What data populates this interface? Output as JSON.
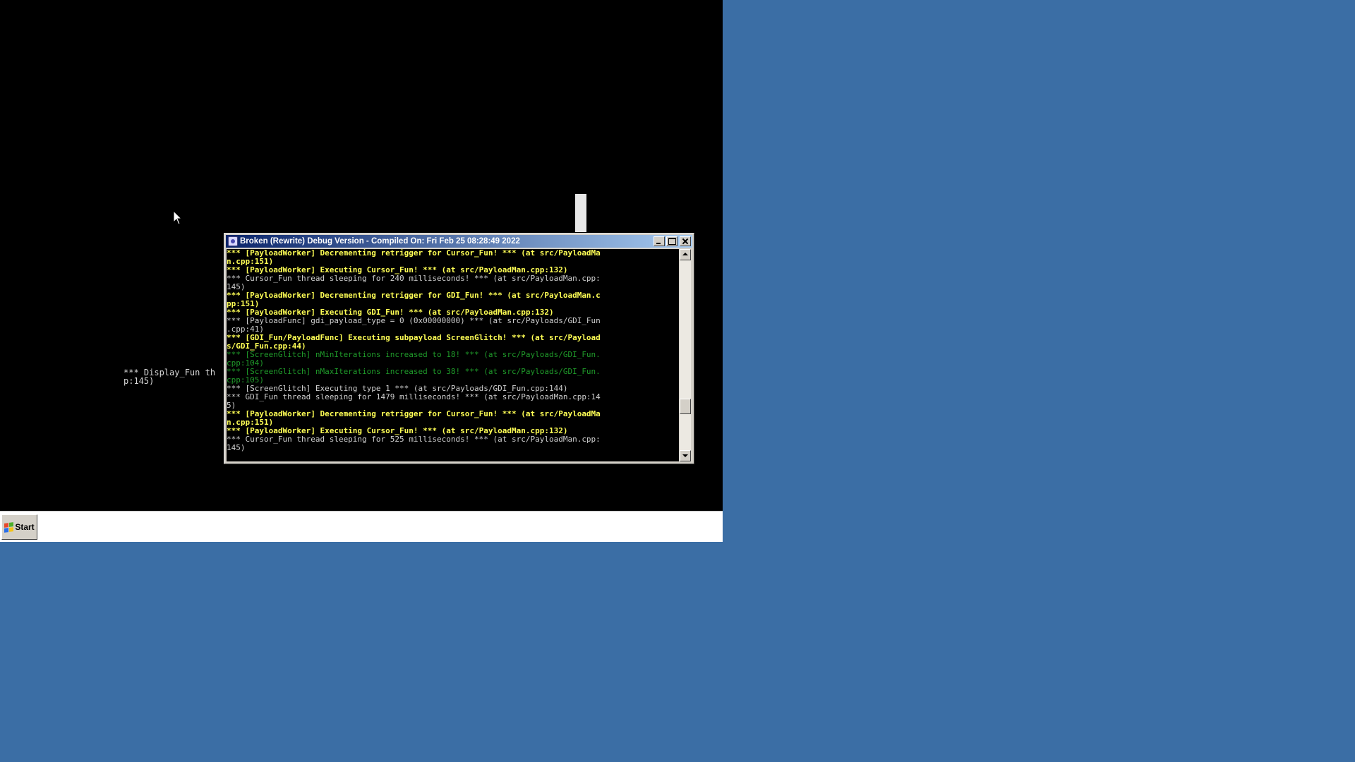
{
  "window": {
    "title": "Broken (Rewrite) Debug Version - Compiled On: Fri Feb 25 08:28:49 2022",
    "icon": "app-icon"
  },
  "console": {
    "lines": [
      {
        "text": "*** [PayloadWorker] Decrementing retrigger for Cursor_Fun! *** (at src/PayloadMa",
        "color": "yellow"
      },
      {
        "text": "n.cpp:151)",
        "color": "yellow"
      },
      {
        "text": "*** [PayloadWorker] Executing Cursor_Fun! *** (at src/PayloadMan.cpp:132)",
        "color": "yellow"
      },
      {
        "text": "*** Cursor_Fun thread sleeping for 240 milliseconds! *** (at src/PayloadMan.cpp:",
        "color": "gray"
      },
      {
        "text": "145)",
        "color": "gray"
      },
      {
        "text": "*** [PayloadWorker] Decrementing retrigger for GDI_Fun! *** (at src/PayloadMan.c",
        "color": "yellow"
      },
      {
        "text": "pp:151)",
        "color": "yellow"
      },
      {
        "text": "*** [PayloadWorker] Executing GDI_Fun! *** (at src/PayloadMan.cpp:132)",
        "color": "yellow"
      },
      {
        "text": "*** [PayloadFunc] gdi_payload_type = 0 (0x00000000) *** (at src/Payloads/GDI_Fun",
        "color": "gray"
      },
      {
        "text": ".cpp:41)",
        "color": "gray"
      },
      {
        "text": "*** [GDI_Fun/PayloadFunc] Executing subpayload ScreenGlitch! *** (at src/Payload",
        "color": "yellow"
      },
      {
        "text": "s/GDI_Fun.cpp:44)",
        "color": "yellow"
      },
      {
        "text": "*** [ScreenGlitch] nMinIterations increased to 18! *** (at src/Payloads/GDI_Fun.",
        "color": "green"
      },
      {
        "text": "cpp:104)",
        "color": "green"
      },
      {
        "text": "*** [ScreenGlitch] nMaxIterations increased to 38! *** (at src/Payloads/GDI_Fun.",
        "color": "green"
      },
      {
        "text": "cpp:105)",
        "color": "green"
      },
      {
        "text": "*** [ScreenGlitch] Executing type 1 *** (at src/Payloads/GDI_Fun.cpp:144)",
        "color": "gray"
      },
      {
        "text": "*** GDI_Fun thread sleeping for 1479 milliseconds! *** (at src/PayloadMan.cpp:14",
        "color": "gray"
      },
      {
        "text": "5)",
        "color": "gray"
      },
      {
        "text": "*** [PayloadWorker] Decrementing retrigger for Cursor_Fun! *** (at src/PayloadMa",
        "color": "yellow"
      },
      {
        "text": "n.cpp:151)",
        "color": "yellow"
      },
      {
        "text": "*** [PayloadWorker] Executing Cursor_Fun! *** (at src/PayloadMan.cpp:132)",
        "color": "yellow"
      },
      {
        "text": "*** Cursor_Fun thread sleeping for 525 milliseconds! *** (at src/PayloadMan.cpp:",
        "color": "gray"
      },
      {
        "text": "145)",
        "color": "gray"
      }
    ]
  },
  "background_text": {
    "line1": "*** Display_Fun th",
    "line2": "p:145)"
  },
  "taskbar": {
    "start_label": "Start"
  },
  "colors": {
    "host_desktop": "#3b6ea5",
    "console_yellow": "#ffff55",
    "console_gray": "#d0d0d0",
    "console_green": "#1f9a2a",
    "titlebar_start": "#0a246a",
    "titlebar_end": "#a6caf0"
  }
}
